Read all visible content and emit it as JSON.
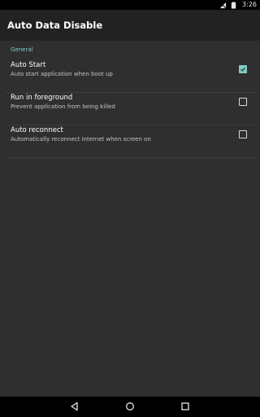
{
  "status_bar": {
    "time": "3:26"
  },
  "app_bar": {
    "title": "Auto Data Disable"
  },
  "section": {
    "header": "General"
  },
  "preferences": [
    {
      "title": "Auto Start",
      "summary": "Auto start application when boot up",
      "checked": true
    },
    {
      "title": "Run in foreground",
      "summary": "Prevent application from being killed",
      "checked": false
    },
    {
      "title": "Auto reconnect",
      "summary": "Automatically reconnect internet when screen on",
      "checked": false
    }
  ],
  "colors": {
    "accent": "#80cbc4",
    "appbar": "#222222",
    "background": "#2f2f2f"
  },
  "icons": {
    "status": [
      "signal-off-icon",
      "battery-icon"
    ],
    "navigation": [
      "back-icon",
      "home-icon",
      "recents-icon"
    ]
  }
}
